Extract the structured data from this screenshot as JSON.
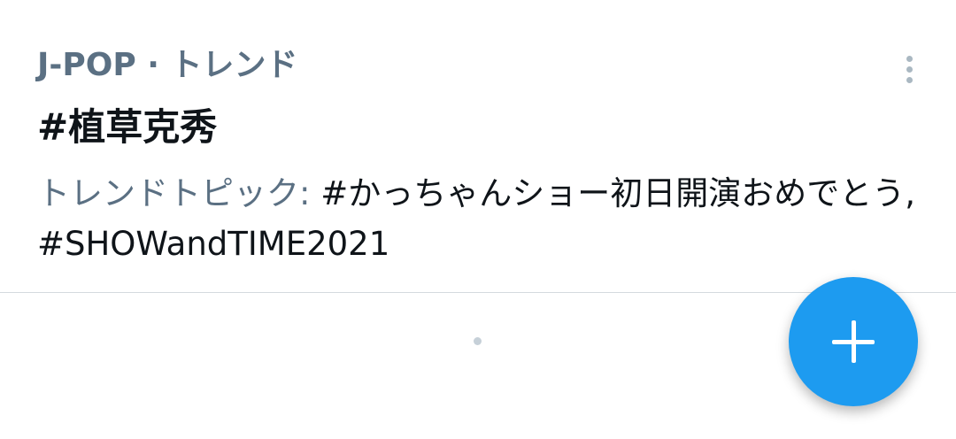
{
  "trend": {
    "context": "J-POP · トレンド",
    "title": "#植草克秀",
    "topics_label": "トレンドトピック: ",
    "topics_value": "#かっちゃんショー初日開演おめでとう, #SHOWandTIME2021"
  },
  "icons": {
    "more": "more-vertical-icon",
    "compose": "plus-icon",
    "loading": "loading-dot"
  },
  "colors": {
    "accent": "#1d9bf0",
    "secondary_text": "#5b7083",
    "primary_text": "#0f1419",
    "divider": "#d4dade"
  }
}
